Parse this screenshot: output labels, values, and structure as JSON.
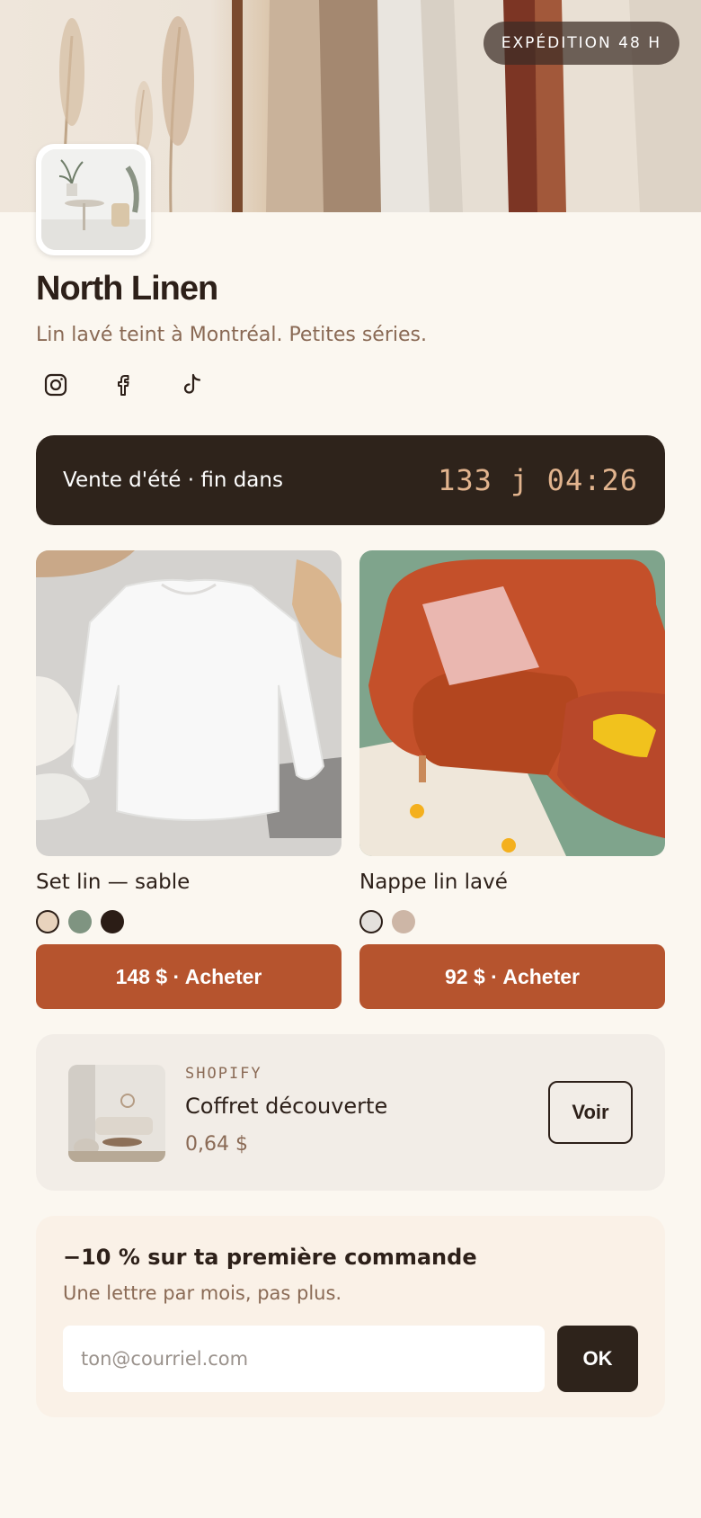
{
  "hero": {
    "badge": "EXPÉDITION 48 H"
  },
  "profile": {
    "name": "North Linen",
    "tagline": "Lin lavé teint à Montréal. Petites séries.",
    "socials": [
      "instagram-icon",
      "facebook-icon",
      "tiktok-icon"
    ]
  },
  "sale": {
    "label": "Vente d'été · fin dans",
    "timer": "133 j 04:26"
  },
  "products": [
    {
      "name": "Set lin — sable",
      "swatches": [
        "#e8d3bd",
        "#7f9481",
        "#2b1d16"
      ],
      "selected_swatch": 0,
      "button": "148 $ · Acheter"
    },
    {
      "name": "Nappe lin lavé",
      "swatches": [
        "#e3e0dc",
        "#cdb6a6"
      ],
      "selected_swatch": 0,
      "button": "92 $ · Acheter"
    }
  ],
  "shopify": {
    "source": "SHOPIFY",
    "title": "Coffret découverte",
    "price": "0,64 $",
    "button": "Voir"
  },
  "newsletter": {
    "title": "−10 % sur ta première commande",
    "subtitle": "Une lettre par mois, pas plus.",
    "placeholder": "ton@courriel.com",
    "button": "OK"
  },
  "colors": {
    "background": "#fbf7f0",
    "text": "#2d2019",
    "muted": "#8a6a55",
    "accent": "#b6542e",
    "dark": "#2e231b",
    "timer": "#e2b48e"
  }
}
